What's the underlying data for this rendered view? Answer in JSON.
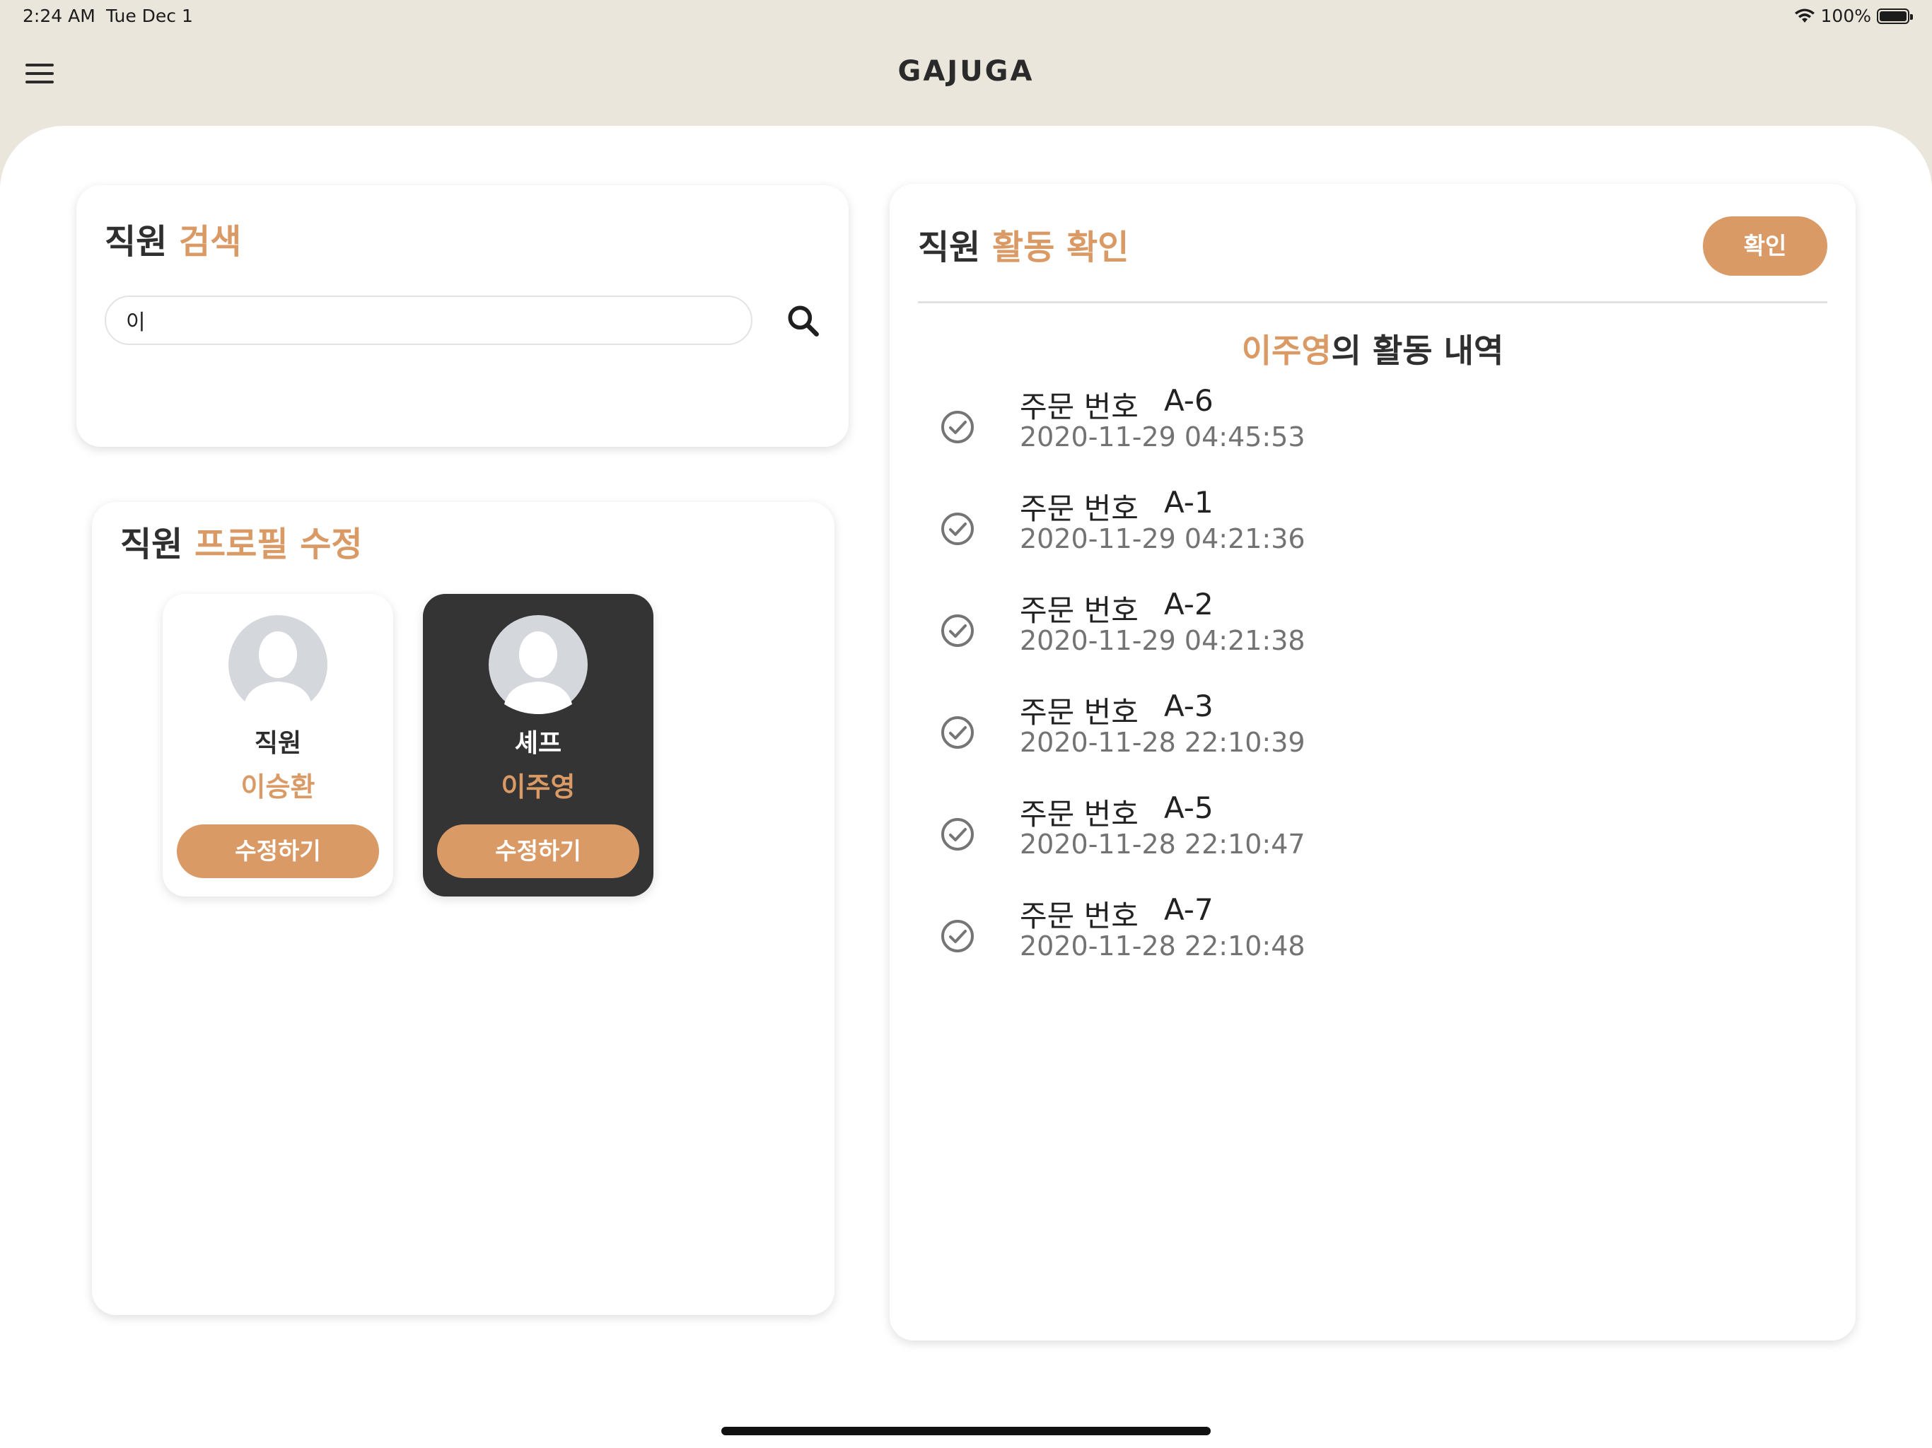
{
  "status_bar": {
    "time": "2:24 AM",
    "date": "Tue Dec 1",
    "battery": "100%"
  },
  "app": {
    "title": "GAJUGA"
  },
  "search_card": {
    "title_prefix": "직원",
    "title_accent": "검색",
    "input_value": "이"
  },
  "profile_card": {
    "title_prefix": "직원",
    "title_accent": "프로필 수정",
    "employees": [
      {
        "role": "직원",
        "name": "이승환",
        "button": "수정하기"
      },
      {
        "role": "셰프",
        "name": "이주영",
        "button": "수정하기"
      }
    ]
  },
  "activity_card": {
    "title_prefix": "직원",
    "title_accent": "활동 확인",
    "confirm_label": "확인",
    "history_name": "이주영",
    "history_suffix": "의 활동 내역",
    "order_label": "주문 번호",
    "items": [
      {
        "order": "A-6",
        "time": "2020-11-29 04:45:53"
      },
      {
        "order": "A-1",
        "time": "2020-11-29 04:21:36"
      },
      {
        "order": "A-2",
        "time": "2020-11-29 04:21:38"
      },
      {
        "order": "A-3",
        "time": "2020-11-28 22:10:39"
      },
      {
        "order": "A-5",
        "time": "2020-11-28 22:10:47"
      },
      {
        "order": "A-7",
        "time": "2020-11-28 22:10:48"
      }
    ]
  },
  "colors": {
    "accent": "#d99a66",
    "header_bg": "#ebe6db",
    "dark_card": "#343434"
  },
  "icons": {
    "menu": "hamburger-icon",
    "search": "search-icon",
    "check": "check-circle-icon",
    "avatar": "person-avatar-icon",
    "wifi": "wifi-icon",
    "battery": "battery-icon"
  }
}
